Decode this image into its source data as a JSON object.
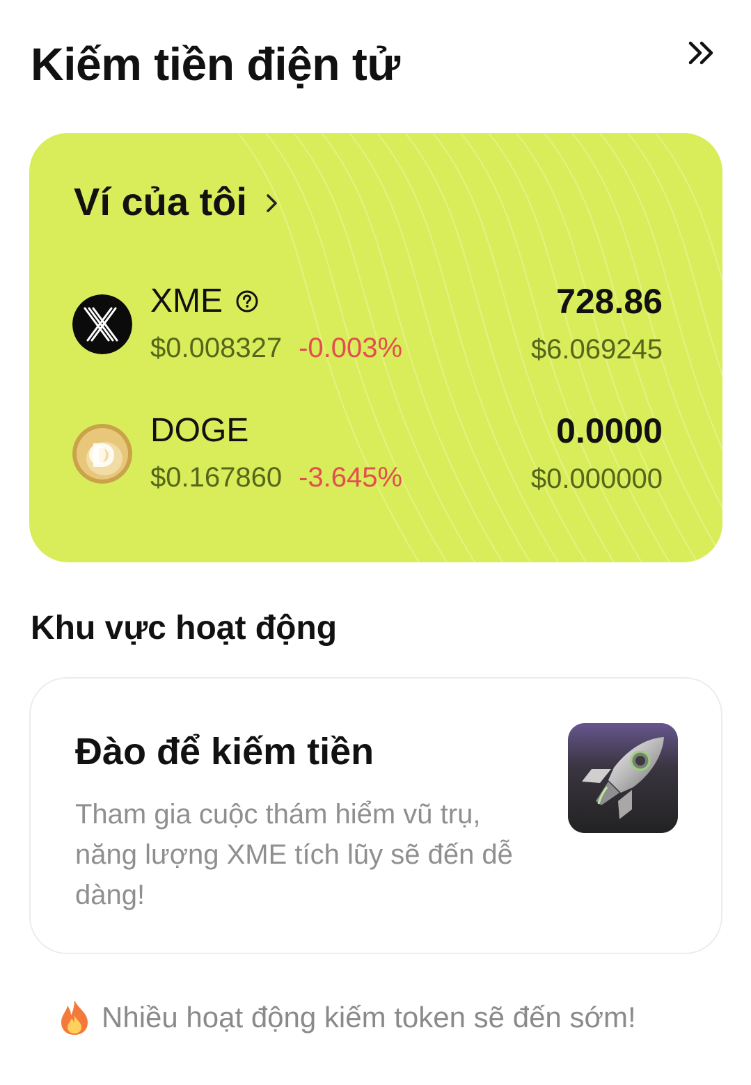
{
  "header": {
    "title": "Kiếm tiền điện tử",
    "expand_icon": "double-chevron-right-icon"
  },
  "wallet": {
    "title": "Ví của tôi",
    "background_color": "#d9ec5a",
    "coins": [
      {
        "symbol": "XME",
        "icon": "xme-logo",
        "price": "$0.008327",
        "change": "-0.003%",
        "amount": "728.86",
        "value": "$6.069245"
      },
      {
        "symbol": "DOGE",
        "icon": "doge-logo",
        "price": "$0.167860",
        "change": "-3.645%",
        "amount": "0.0000",
        "value": "$0.000000"
      }
    ]
  },
  "activity": {
    "section_title": "Khu vực hoạt động",
    "card": {
      "title": "Đào để kiếm tiền",
      "description": "Tham gia cuộc thám hiểm vũ trụ, năng lượng XME tích lũy sẽ đến dễ dàng!",
      "image": "rocket-icon"
    }
  },
  "footer": {
    "icon": "fire-icon",
    "text": "Nhiều hoạt động kiếm token sẽ đến sớm!"
  },
  "colors": {
    "negative_change": "#e24e4e",
    "muted_green": "#55661a",
    "muted_gray": "#8f8f8f"
  }
}
